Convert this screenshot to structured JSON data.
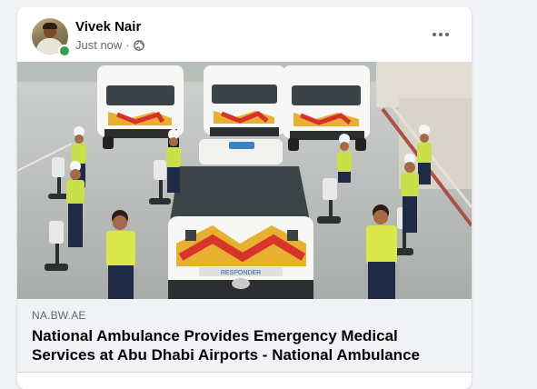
{
  "post": {
    "author": "Vivek Nair",
    "timestamp": "Just now",
    "separator": "·",
    "privacy_icon": "globe-icon",
    "more_icon": "more-options-icon",
    "online_color": "#31a24c"
  },
  "link_preview": {
    "domain": "NA.BW.AE",
    "title": "National Ambulance Provides Emergency Medical Services at Abu Dhabi Airports - National Ambulance",
    "vehicle_label": "RESPONDER"
  }
}
